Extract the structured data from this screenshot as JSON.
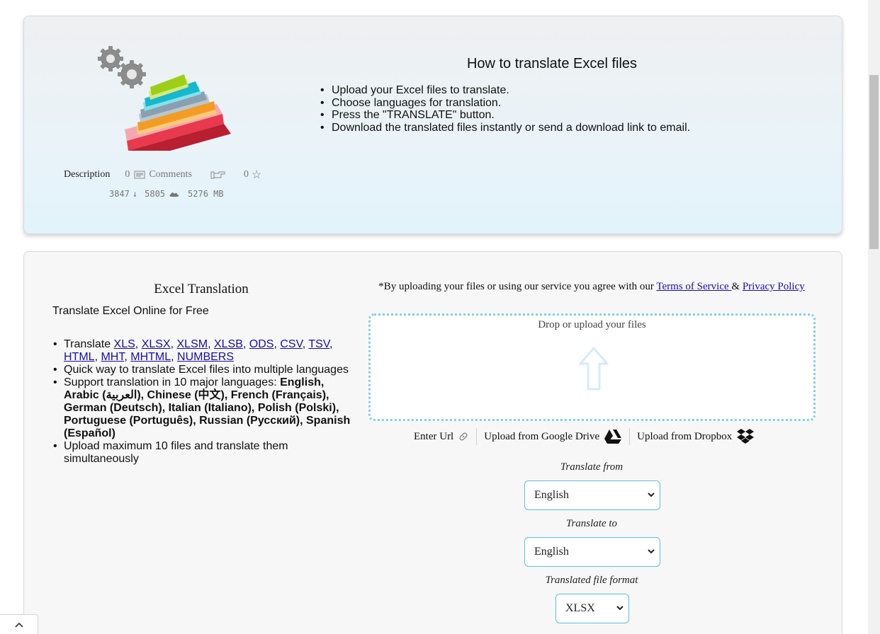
{
  "howto": {
    "title": "How to translate Excel files",
    "steps": [
      "Upload your Excel files to translate.",
      "Choose languages for translation.",
      "Press the \"TRANSLATE\" button.",
      "Download the translated files instantly or send a download link to email."
    ]
  },
  "meta": {
    "description_label": "Description",
    "comments_count": "0",
    "comments_label": "Comments",
    "rating": "0",
    "downloads": "3847",
    "uploads": "5805",
    "size": "5276 MB"
  },
  "tool": {
    "title": "Excel Translation",
    "subtitle": "Translate Excel Online for Free",
    "translate_prefix": "Translate ",
    "formats": [
      "XLS",
      "XLSX",
      "XLSM",
      "XLSB",
      "ODS",
      "CSV",
      "TSV",
      "HTML",
      "MHT",
      "MHTML",
      "NUMBERS"
    ],
    "feature_quick": "Quick way to translate Excel files into multiple languages",
    "support_prefix": "Support translation in 10 major languages: ",
    "languages_bold": "English, Arabic (العربية), Chinese (中文), French (Français), German (Deutsch), Italian (Italiano), Polish (Polski), Portuguese (Português), Russian (Русский), Spanish (Español)",
    "feature_upload": "Upload maximum 10 files and translate them simultaneously"
  },
  "agreement": {
    "prefix": "*By uploading your files or using our service you agree with our ",
    "terms_link": "Terms of Service ",
    "amp": "& ",
    "privacy_link": "Privacy Policy"
  },
  "upload": {
    "drop_label": "Drop or upload your files",
    "enter_url": "Enter Url",
    "google_drive": "Upload from Google Drive",
    "dropbox": "Upload from Dropbox"
  },
  "form": {
    "from_label": "Translate from",
    "from_value": "English",
    "to_label": "Translate to",
    "to_value": "English",
    "format_label": "Translated file format",
    "format_value": "XLSX"
  },
  "colors": {
    "link": "#1a0dab",
    "accent_border": "#5bc0de",
    "dropzone_border": "#7fd0ea"
  }
}
